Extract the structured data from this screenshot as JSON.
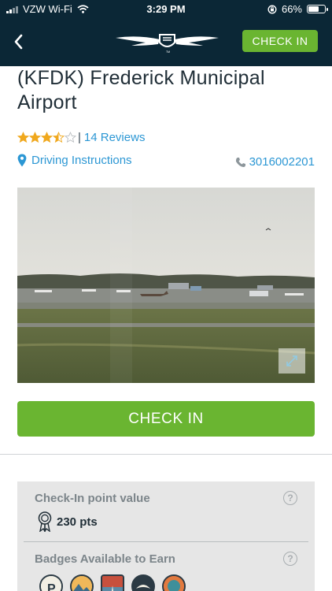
{
  "status_bar": {
    "carrier": "VZW Wi-Fi",
    "time": "3:29 PM",
    "battery": "66%",
    "battery_level": 0.66
  },
  "nav": {
    "check_in_label": "CHECK IN",
    "back_icon": "chevron-left-icon",
    "logo": "wings-logo"
  },
  "airport": {
    "title": "(KFDK) Frederick Municipal Airport",
    "rating": 3.5,
    "rating_max": 5,
    "rating_separator": "|",
    "reviews_label": "14 Reviews",
    "directions_label": "Driving Instructions",
    "phone": "3016002201"
  },
  "main_check_in_label": "CHECK IN",
  "info": {
    "points_label": "Check-In point value",
    "points_value": "230 pts",
    "badges_label": "Badges Available to Earn",
    "help_symbol": "?"
  },
  "colors": {
    "header_bg": "#0b2736",
    "accent_green": "#6ab531",
    "link_blue": "#2c97d4",
    "star_gold": "#f0a81e"
  }
}
